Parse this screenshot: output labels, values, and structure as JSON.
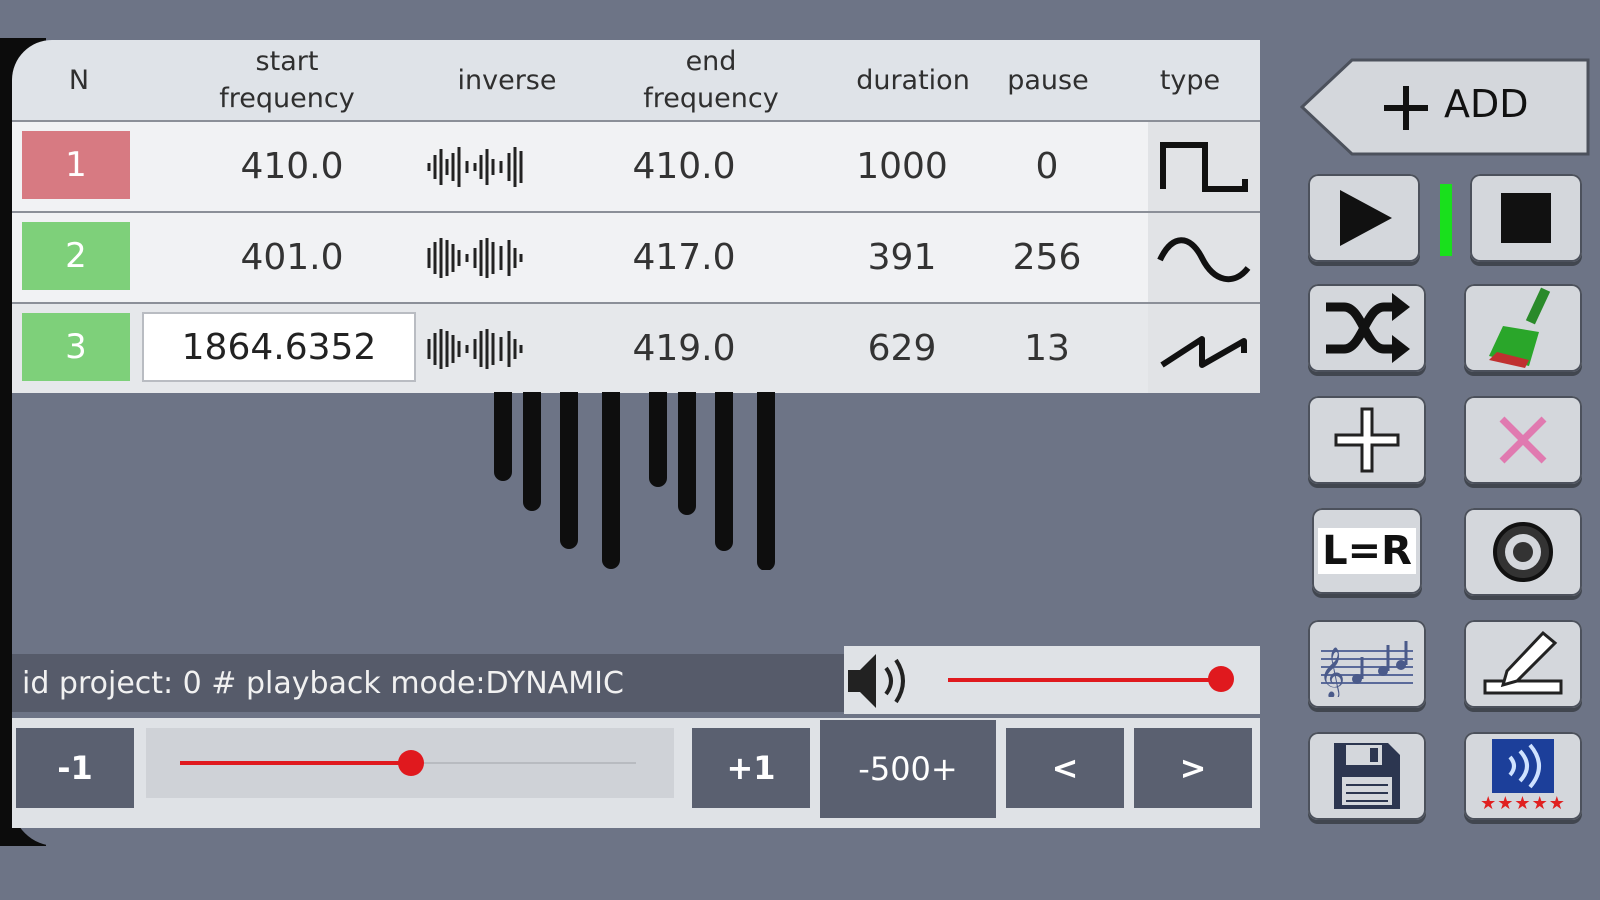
{
  "table": {
    "headers": {
      "n": "N",
      "start_frequency": "start frequency",
      "inverse": "inverse",
      "end_frequency": "end frequency",
      "duration": "duration",
      "pause": "pause",
      "type": "type"
    },
    "rows": [
      {
        "n": "1",
        "start": "410.0",
        "end": "410.0",
        "duration": "1000",
        "pause": "0",
        "type_icon": "square-wave-icon",
        "color": "#d77a82"
      },
      {
        "n": "2",
        "start": "401.0",
        "end": "417.0",
        "duration": "391",
        "pause": "256",
        "type_icon": "sine-wave-icon",
        "color": "#7ed07a"
      },
      {
        "n": "3",
        "start": "1864.6352",
        "end": "419.0",
        "duration": "629",
        "pause": "13",
        "type_icon": "sawtooth-wave-icon",
        "color": "#7ed07a"
      }
    ]
  },
  "status": {
    "text": "id project: 0 # playback mode:DYNAMIC"
  },
  "volume": {
    "level": 1.0
  },
  "controls": {
    "minus_one": "-1",
    "plus_one": "+1",
    "step": "-500+",
    "prev": "<",
    "next": ">",
    "slider_level": 0.48
  },
  "sidebar": {
    "add_label": "ADD",
    "lr_label": "L=R",
    "rating_stars": "★★★★★"
  },
  "colors": {
    "accent_red": "#e0191e",
    "led_green": "#19e01c",
    "row_red": "#d77a82",
    "row_green": "#7ed07a"
  }
}
